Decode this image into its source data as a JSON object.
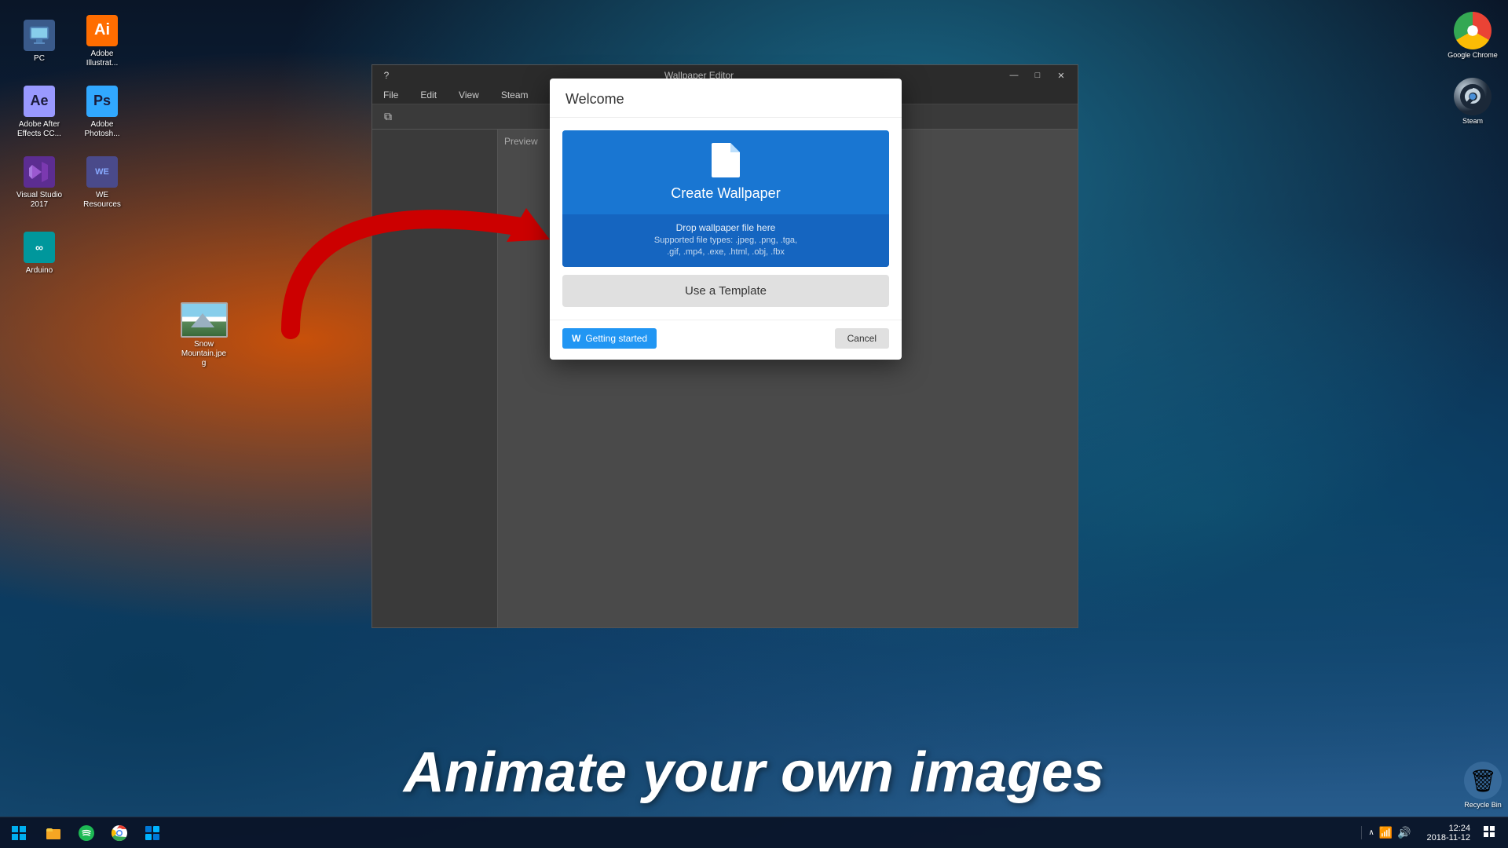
{
  "desktop": {
    "background_desc": "space nebula with orange and blue tones"
  },
  "desktop_icons": [
    {
      "id": "pc",
      "label": "PC",
      "icon_type": "pc",
      "icon_color": "#4a6fa5",
      "icon_char": "🖥"
    },
    {
      "id": "adobe_illustrator",
      "label": "Adobe\nIllustrat...",
      "icon_type": "ai",
      "icon_color": "#FF6D00",
      "icon_char": "Ai"
    },
    {
      "id": "adobe_after_effects",
      "label": "Adobe After\nEffects CC...",
      "icon_type": "ae",
      "icon_color": "#9999FF",
      "icon_char": "Ae"
    },
    {
      "id": "adobe_photoshop",
      "label": "Adobe\nPhotosh...",
      "icon_type": "ps",
      "icon_color": "#31A8FF",
      "icon_char": "Ps"
    },
    {
      "id": "visual_studio",
      "label": "Visual Studio\n2017",
      "icon_type": "vs",
      "icon_color": "#5C2D91",
      "icon_char": "VS"
    },
    {
      "id": "we_resources",
      "label": "WE\nResources",
      "icon_type": "we",
      "icon_color": "#4a4a8a",
      "icon_char": "WE"
    },
    {
      "id": "arduino",
      "label": "Arduino",
      "icon_type": "arduino",
      "icon_color": "#00979C",
      "icon_char": "⚙"
    }
  ],
  "file_on_desktop": {
    "name": "Snow\nMountain.jpe\ng",
    "type": "image"
  },
  "tray_apps": [
    {
      "id": "google_chrome",
      "label": "Google Chrome"
    },
    {
      "id": "steam",
      "label": "Steam"
    }
  ],
  "window": {
    "title": "Wallpaper Editor",
    "menu_items": [
      "File",
      "Edit",
      "View",
      "Steam"
    ],
    "toolbar_preview": "Preview"
  },
  "dialog": {
    "title": "Welcome",
    "create_wallpaper": {
      "title": "Create Wallpaper",
      "drop_text": "Drop wallpaper file here",
      "supported_text": "Supported file types: .jpeg, .png, .tga,\n.gif, .mp4, .exe, .html, .obj, .fbx"
    },
    "use_template_label": "Use a Template",
    "getting_started_label": "Getting started",
    "cancel_label": "Cancel"
  },
  "bottom_text": "Animate your own images",
  "taskbar": {
    "time": "12:24",
    "date": "2018-11-12"
  },
  "recycle_bin": {
    "label": "Recycle Bin"
  }
}
